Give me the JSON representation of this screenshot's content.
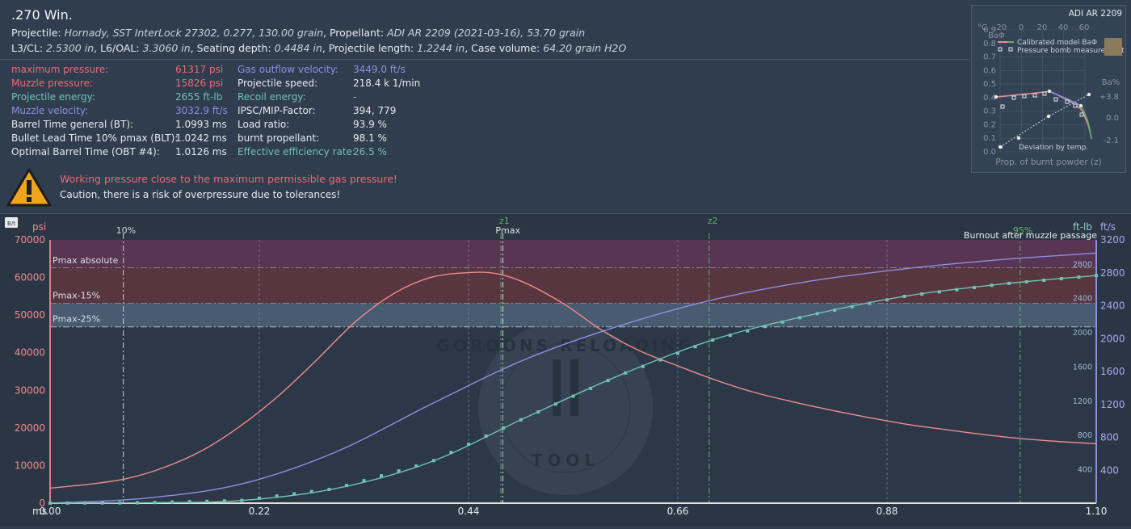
{
  "header": {
    "title": ".270 Win.",
    "line1": [
      {
        "label": "Projectile: ",
        "value": "Hornady, SST InterLock 27302, 0.277, 130.00 grain"
      },
      {
        "label": ", Propellant: ",
        "value": "ADI AR 2209 (2021-03-16), 53.70 grain"
      }
    ],
    "line2": [
      {
        "label": "L3/CL: ",
        "value": "2.5300 in"
      },
      {
        "label": ", L6/OAL: ",
        "value": "3.3060 in"
      },
      {
        "label": ", Seating depth: ",
        "value": "0.4484 in"
      },
      {
        "label": ", Projectile length: ",
        "value": "1.2244 in"
      },
      {
        "label": ", Case volume: ",
        "value": "64.20 grain H2O"
      }
    ]
  },
  "results_left": [
    {
      "label": "maximum pressure:",
      "value": "61317 psi",
      "color": "#e96b73"
    },
    {
      "label": "Muzzle pressure:",
      "value": "15826 psi",
      "color": "#e96b73"
    },
    {
      "label": "Projectile energy:",
      "value": "2655 ft-lb",
      "color": "#6fc2b4"
    },
    {
      "label": "Muzzle velocity:",
      "value": "3032.9 ft/s",
      "color": "#8d8fe0"
    },
    {
      "label": "Barrel Time general (BT):",
      "value": "1.0993 ms",
      "color": "#e6eaee"
    },
    {
      "label": "Bullet Lead Time 10% pmax (BLT):",
      "value": "1.0242 ms",
      "color": "#e6eaee"
    },
    {
      "label": "Optimal Barrel Time (OBT #4):",
      "value": "1.0126 ms",
      "color": "#e6eaee"
    }
  ],
  "results_right": [
    {
      "label": "Gas outflow velocity:",
      "value": "3449.0 ft/s",
      "color": "#8d8fe0"
    },
    {
      "label": "Projectile speed:",
      "value": "218.4 k 1/min",
      "color": "#e6eaee"
    },
    {
      "label": "Recoil energy:",
      "value": "-",
      "color": "#6fc2b4"
    },
    {
      "label": "IPSC/MIP-Factor:",
      "value": "394, 779",
      "color": "#e6eaee"
    },
    {
      "label": "Load ratio:",
      "value": "93.9 %",
      "color": "#e6eaee"
    },
    {
      "label": "burnt propellant:",
      "value": "98.1 %",
      "color": "#e6eaee"
    },
    {
      "label": "Effective efficiency rate:",
      "value": "26.5 %",
      "color": "#6fc2b4"
    }
  ],
  "warning": {
    "title": "Working pressure close to the maximum permissible gas pressure!",
    "text": "Caution, there is a risk of overpressure due to tolerances!",
    "icon": "warning-triangle-icon"
  },
  "chart_toolbar": {
    "icon_label": "B/t"
  },
  "chart_data": {
    "type": "line",
    "xlabel": "ms",
    "xlim": [
      0,
      1.1
    ],
    "x_ticks": [
      "0.00",
      "0.22",
      "0.44",
      "0.66",
      "0.88",
      "1.10"
    ],
    "y_left": {
      "label": "psi",
      "lim": [
        0,
        70000
      ],
      "ticks": [
        "0",
        "10000",
        "20000",
        "30000",
        "40000",
        "50000",
        "60000",
        "70000"
      ]
    },
    "y_right_energy": {
      "label": "ft-lb",
      "lim": [
        0,
        2800
      ],
      "ticks": [
        "400",
        "800",
        "1200",
        "1600",
        "2000",
        "2400",
        "2800"
      ]
    },
    "y_right_velocity": {
      "label": "ft/s",
      "lim": [
        0,
        3200
      ],
      "ticks": [
        "400",
        "800",
        "1200",
        "1600",
        "2000",
        "2400",
        "2800",
        "3200"
      ]
    },
    "bands": [
      {
        "label": "Pmax absolute",
        "from": 62500,
        "to": 70000,
        "color": "#5a3554"
      },
      {
        "label": "Pmax-15%",
        "from": 53125,
        "to": 62500,
        "color": "#5a3640"
      },
      {
        "label": "Pmax-25%",
        "from": 46875,
        "to": 53125,
        "color": "#4a5d74"
      }
    ],
    "markers": [
      {
        "label": "10%",
        "x": 0.077
      },
      {
        "label": "z1",
        "x": 0.474
      },
      {
        "label": "Pmax",
        "x": 0.476
      },
      {
        "label": "z2",
        "x": 0.693
      },
      {
        "label": "95%",
        "x": 1.02
      }
    ],
    "annotation": "Burnout after muzzle passage",
    "series": [
      {
        "name": "pressure",
        "color": "#ef8a8e",
        "axis": "psi",
        "x": [
          0,
          0.04,
          0.08,
          0.12,
          0.16,
          0.2,
          0.24,
          0.28,
          0.32,
          0.36,
          0.4,
          0.44,
          0.47,
          0.5,
          0.54,
          0.58,
          0.62,
          0.66,
          0.7,
          0.74,
          0.78,
          0.82,
          0.86,
          0.9,
          0.94,
          0.98,
          1.02,
          1.06,
          1.1
        ],
        "values": [
          4000,
          5000,
          6500,
          9500,
          14000,
          20500,
          28500,
          38000,
          48000,
          55500,
          60000,
          61300,
          61000,
          58500,
          53000,
          46000,
          40500,
          36500,
          32700,
          29500,
          27000,
          24800,
          22800,
          21000,
          19600,
          18300,
          17200,
          16400,
          15800
        ]
      },
      {
        "name": "velocity",
        "color": "#8d8fe0",
        "axis": "ft/s",
        "x": [
          0,
          0.1,
          0.2,
          0.3,
          0.4,
          0.5,
          0.6,
          0.7,
          0.8,
          0.9,
          1.0,
          1.1
        ],
        "values": [
          0,
          60,
          230,
          620,
          1200,
          1750,
          2160,
          2480,
          2700,
          2850,
          2960,
          3040
        ]
      },
      {
        "name": "energy",
        "color": "#6fc2b4",
        "axis": "ft-lb",
        "x": [
          0,
          0.1,
          0.2,
          0.3,
          0.4,
          0.5,
          0.6,
          0.7,
          0.8,
          0.9,
          1.0,
          1.1
        ],
        "values": [
          0,
          5,
          30,
          170,
          480,
          1000,
          1500,
          1920,
          2200,
          2420,
          2560,
          2660
        ]
      }
    ]
  },
  "inset": {
    "title": "ADI AR 2209",
    "legend": [
      "Calibrated model BaΦ",
      "Pressure bomb measurement"
    ],
    "footer_legend": "Deviation by temp.",
    "xlabel": "Prop. of burnt powder (z)",
    "ylabel_left": "BaΦ",
    "ylabel_right": "Ba%",
    "temp_label": "°C",
    "temp_ticks": [
      "-20",
      "0",
      "20",
      "40",
      "60"
    ],
    "y_ticks": [
      "0.0",
      "0.1",
      "0.2",
      "0.3",
      "0.4",
      "0.5",
      "0.6",
      "0.7",
      "0.8",
      "0.9"
    ],
    "right_ticks": [
      "+3.8",
      "0.0",
      "-2.1"
    ]
  },
  "watermark": {
    "top": "GORDONS RELOADING",
    "bottom": "TOOL"
  }
}
